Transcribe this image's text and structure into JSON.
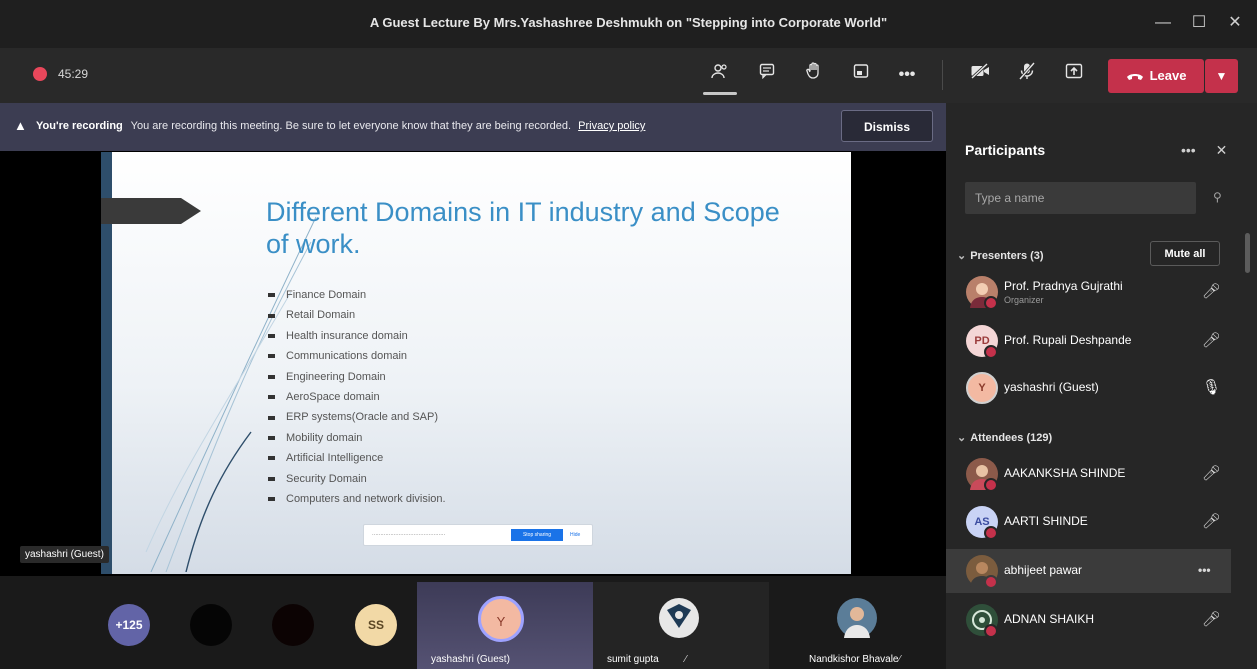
{
  "window": {
    "title": "A Guest Lecture By Mrs.Yashashree Deshmukh on \"Stepping into Corporate World\"",
    "controls": {
      "minimize": "—",
      "maximize": "☐",
      "close": "✕"
    }
  },
  "toolbar": {
    "timer": "45:29",
    "leave_label": "Leave",
    "icons": [
      "people-icon",
      "chat-icon",
      "raise-hand-icon",
      "rooms-icon",
      "more-icon",
      "camera-off-icon",
      "mic-off-icon",
      "share-icon"
    ],
    "colors": {
      "leave": "#c4314b",
      "record": "#e8475b"
    }
  },
  "banner": {
    "heading": "You're recording",
    "message": "You are recording this meeting. Be sure to let everyone know that they are being recorded.",
    "link": "Privacy policy",
    "dismiss_label": "Dismiss"
  },
  "slide": {
    "title": "Different Domains in IT industry and Scope of work.",
    "bullets": [
      "Finance Domain",
      "Retail Domain",
      "Health insurance domain",
      "Communications domain",
      "Engineering Domain",
      "AeroSpace domain",
      "ERP systems(Oracle and SAP)",
      "Mobility domain",
      "Artificial Intelligence",
      "Security Domain",
      "Computers and network division."
    ],
    "share_stop": "Stop sharing",
    "share_hide": "Hide"
  },
  "stage": {
    "speaker_tag": "yashashri (Guest)"
  },
  "strip": {
    "overflow_count": "+125",
    "initials": "SS",
    "active_initial": "Y",
    "names": [
      "yashashri (Guest)",
      "sumit gupta",
      "Nandkishor Bhavale"
    ]
  },
  "panel": {
    "title": "Participants",
    "search_placeholder": "Type a name",
    "presenters_label": "Presenters (3)",
    "mute_all": "Mute all",
    "presenters": [
      {
        "name": "Prof. Pradnya Gujrathi",
        "role": "Organizer",
        "initials": ""
      },
      {
        "name": "Prof. Rupali Deshpande",
        "role": "",
        "initials": "PD"
      },
      {
        "name": "yashashri (Guest)",
        "role": "",
        "initials": "Y"
      }
    ],
    "attendees_label": "Attendees (129)",
    "attendees": [
      {
        "name": "AAKANKSHA SHINDE",
        "initials": ""
      },
      {
        "name": "AARTI SHINDE",
        "initials": "AS"
      },
      {
        "name": "abhijeet pawar",
        "initials": ""
      },
      {
        "name": "ADNAN SHAIKH",
        "initials": ""
      }
    ]
  }
}
